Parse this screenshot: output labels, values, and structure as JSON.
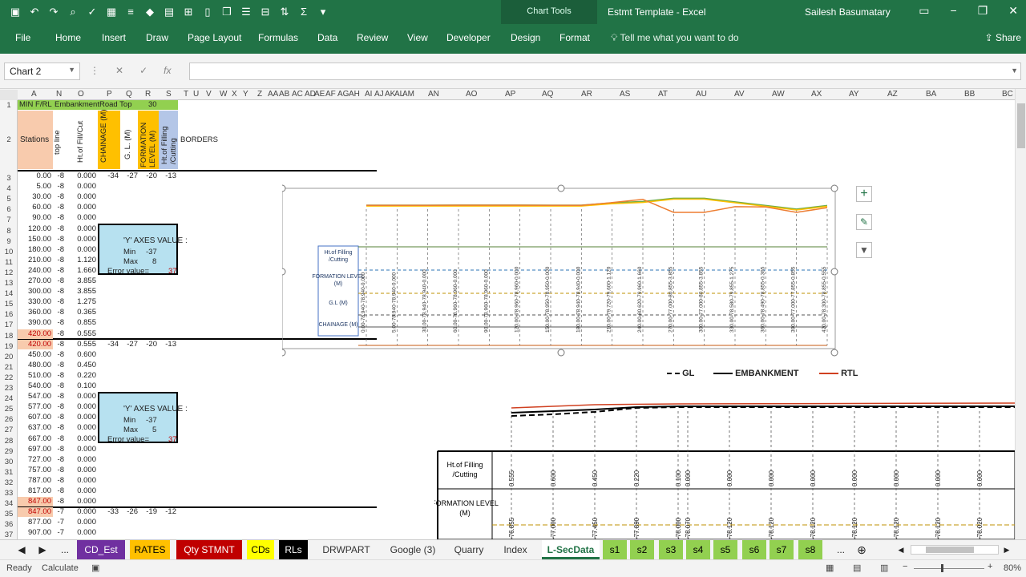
{
  "window": {
    "doc_title": "Estmt Template  -  Excel",
    "user_name": "Sailesh Basumatary",
    "context_group": "Chart Tools"
  },
  "ribbon": {
    "tabs": [
      "File",
      "Home",
      "Insert",
      "Draw",
      "Page Layout",
      "Formulas",
      "Data",
      "Review",
      "View",
      "Developer",
      "Design",
      "Format"
    ],
    "tell_me": "Tell me what you want to do",
    "share": "Share"
  },
  "formula_bar": {
    "name_box": "Chart 2",
    "fx": "fx"
  },
  "columns": [
    "A",
    "N",
    "O",
    "P",
    "Q",
    "R",
    "S",
    "T",
    "U",
    "V",
    "W",
    "X",
    "Y",
    "Z",
    "AA",
    "AB",
    "AC",
    "AD",
    "AE",
    "AF",
    "AG",
    "AH",
    "AI",
    "AJ",
    "AK",
    "AL",
    "AM",
    "AN",
    "AO",
    "AP",
    "AQ",
    "AR",
    "AS",
    "AT",
    "AU",
    "AV",
    "AW",
    "AX",
    "AY",
    "AZ",
    "BA",
    "BB",
    "BC"
  ],
  "rows": [
    "1",
    "2",
    "3",
    "4",
    "5",
    "6",
    "7",
    "8",
    "9",
    "10",
    "11",
    "12",
    "13",
    "14",
    "15",
    "16",
    "17",
    "18",
    "19",
    "20",
    "21",
    "22",
    "23",
    "24",
    "25",
    "26",
    "27",
    "28",
    "29",
    "30",
    "31",
    "32",
    "33",
    "34",
    "35",
    "36",
    "37"
  ],
  "sheet": {
    "row1": {
      "a": "MIN F/RL",
      "n": "Embankment",
      "p": "Road Top",
      "r": "30"
    },
    "headers": {
      "stations": "Stations",
      "top_line": "top line",
      "ht_fill": "Ht.of Fill/Cut",
      "chainage": "CHAINAGE (M)",
      "gl": "G. L. (M)",
      "formation": "FORMATION LEVEL (M)",
      "ht_filling": "Ht.of Filling /Cutting",
      "borders": "BORDERS"
    },
    "stations": [
      "0.00",
      "5.00",
      "30.00",
      "60.00",
      "90.00",
      "120.00",
      "150.00",
      "180.00",
      "210.00",
      "240.00",
      "270.00",
      "300.00",
      "330.00",
      "360.00",
      "390.00",
      "420.00",
      "420.00",
      "450.00",
      "480.00",
      "510.00",
      "540.00",
      "547.00",
      "577.00",
      "607.00",
      "637.00",
      "667.00",
      "697.00",
      "727.00",
      "757.00",
      "787.00",
      "817.00",
      "847.00",
      "847.00",
      "877.00",
      "907.00"
    ],
    "top_line": [
      "-8",
      "-8",
      "-8",
      "-8",
      "-8",
      "-8",
      "-8",
      "-8",
      "-8",
      "-8",
      "-8",
      "-8",
      "-8",
      "-8",
      "-8",
      "-8",
      "-8",
      "-8",
      "-8",
      "-8",
      "-8",
      "-8",
      "-8",
      "-8",
      "-8",
      "-8",
      "-8",
      "-8",
      "-8",
      "-8",
      "-8",
      "-8",
      "-7",
      "-7",
      "-7"
    ],
    "fill_cut": [
      "0.000",
      "0.000",
      "0.000",
      "0.000",
      "0.000",
      "0.000",
      "0.000",
      "0.000",
      "1.120",
      "1.660",
      "3.855",
      "3.855",
      "1.275",
      "0.365",
      "0.855",
      "0.555",
      "0.555",
      "0.600",
      "0.450",
      "0.220",
      "0.100",
      "0.000",
      "0.000",
      "0.000",
      "0.000",
      "0.000",
      "0.000",
      "0.000",
      "0.000",
      "0.000",
      "0.000",
      "0.000",
      "0.000",
      "0.000",
      "0.000"
    ],
    "axes_box1": {
      "title": "'Y' AXES VALUE :",
      "min_label": "Min",
      "min": "-37",
      "max_label": "Max",
      "max": "8",
      "err_label": "Error value=",
      "err": "37"
    },
    "axes_box2": {
      "title": "'Y' AXES VALUE :",
      "min_label": "Min",
      "min": "-37",
      "max_label": "Max",
      "max": "5",
      "err_label": "Error value=",
      "err": "37"
    },
    "r3": [
      "-34",
      "-27",
      "-20",
      "-13"
    ],
    "r19": [
      "-34",
      "-27",
      "-20",
      "-13"
    ],
    "r35": [
      "-33",
      "-26",
      "-19",
      "-12"
    ]
  },
  "chart1": {
    "row_labels": [
      "Ht.of Filling /Cutting",
      "FORMATION LEVEL (M)",
      "G.L (M)",
      "CHAINAGE (M)"
    ],
    "columns": [
      "0.00",
      "5.00",
      "30.00",
      "60.00",
      "90.00",
      "120.00",
      "150.00",
      "180.00",
      "210.00",
      "240.00",
      "270.00",
      "300.00",
      "330.00",
      "360.00",
      "390.00",
      "420.00"
    ],
    "gl": [
      "78.940",
      "78.940",
      "78.940",
      "78.960",
      "78.960",
      "78.960",
      "78.950",
      "78.940",
      "79.720",
      "80.620",
      "77.000",
      "77.000",
      "78.580",
      "78.490",
      "77.000",
      "78.300"
    ],
    "formation": [
      "78.940",
      "78.940",
      "78.940",
      "78.960",
      "78.960",
      "78.960",
      "78.950",
      "78.940",
      "79.600",
      "79.960",
      "80.855",
      "80.855",
      "79.855",
      "78.855",
      "77.855",
      "78.855"
    ],
    "fill": [
      "0.000",
      "0.000",
      "0.000",
      "0.000",
      "0.000",
      "0.000",
      "0.000",
      "0.000",
      "1.120",
      "1.660",
      "3.855",
      "3.855",
      "1.275",
      "0.365",
      "0.855",
      "0.555"
    ]
  },
  "legend": {
    "gl": "GL",
    "embankment": "EMBANKMENT",
    "rtl": "RTL"
  },
  "chart2": {
    "row_labels": [
      "Ht.of Filling /Cutting",
      "FORMATION LEVEL (M)"
    ],
    "fill": [
      "0.555",
      "0.600",
      "0.450",
      "0.220",
      "0.100",
      "0.000",
      "0.000",
      "0.000",
      "0.000",
      "0.000",
      "0.000",
      "0.000",
      "0.000"
    ],
    "formation_prefix": [
      "76.855",
      "77.000",
      "77.450",
      "77.890",
      "78.000",
      "78.070",
      "78.120",
      "78.120",
      "78.120",
      "78.120",
      "78.120",
      "78.120",
      "78.020"
    ],
    "formation_labels": [
      "-76.855",
      "-77.000",
      "-77.450",
      "-77.890",
      "-78.000",
      "-78.070",
      "-78.120",
      "-78.120",
      "-78.120",
      "-78.120",
      "-78.120",
      "-78.120",
      "-78.020"
    ]
  },
  "sheet_tabs": [
    "CD_Est",
    "RATES",
    "Qty STMNT",
    "CDs",
    "RLs",
    "DRWPART",
    "Google (3)",
    "Quarry",
    "Index",
    "L-SecData",
    "s1",
    "s2",
    "s3",
    "s4",
    "s5",
    "s6",
    "s7",
    "s8"
  ],
  "tab_colors": {
    "CD_Est": "#7030a0",
    "RATES": "#ffc000",
    "Qty STMNT": "#c00000",
    "CDs": "#ffff00",
    "RLs": "#000000",
    "s": "#92d050"
  },
  "status": {
    "ready": "Ready",
    "calculate": "Calculate",
    "zoom": "80%"
  },
  "icons": [
    "save-icon",
    "undo-icon",
    "redo-icon",
    "plus-icon",
    "brush-icon",
    "filter-icon"
  ]
}
